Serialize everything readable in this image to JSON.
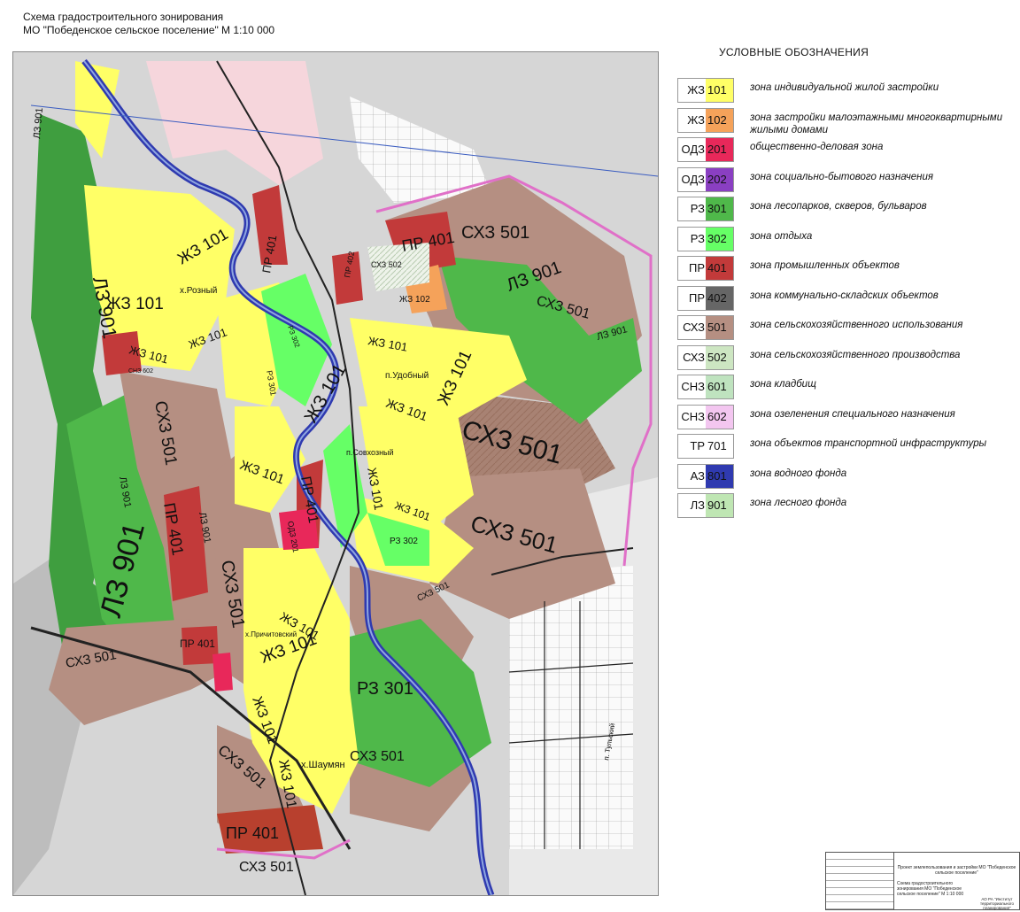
{
  "header": {
    "line1": "Схема градостроительного зонирования",
    "line2": "МО \"Победенское сельское поселение\" М 1:10 000"
  },
  "legend": {
    "title": "УСЛОВНЫЕ ОБОЗНАЧЕНИЯ",
    "items": [
      {
        "prefix": "ЖЗ",
        "num": "101",
        "color": "#ffff66",
        "desc": "зона индивидуальной жилой застройки"
      },
      {
        "prefix": "ЖЗ",
        "num": "102",
        "color": "#f5a25a",
        "desc": "зона застройки малоэтажными многоквартирными жилыми домами"
      },
      {
        "prefix": "ОДЗ",
        "num": "201",
        "color": "#e8285a",
        "desc": "общественно-деловая зона"
      },
      {
        "prefix": "ОДЗ",
        "num": "202",
        "color": "#8a3fc2",
        "desc": "зона социально-бытового назначения"
      },
      {
        "prefix": "РЗ",
        "num": "301",
        "color": "#4fb84a",
        "desc": "зона лесопарков, скверов, бульваров"
      },
      {
        "prefix": "РЗ",
        "num": "302",
        "color": "#66ff66",
        "desc": "зона отдыха"
      },
      {
        "prefix": "ПР",
        "num": "401",
        "color": "#c23a3a",
        "desc": "зона промышленных объектов"
      },
      {
        "prefix": "ПР",
        "num": "402",
        "color": "#666666",
        "desc": "зона коммунально-складских объектов"
      },
      {
        "prefix": "СХЗ",
        "num": "501",
        "color": "#b58f82",
        "desc": "зона сельскохозяйственного использования"
      },
      {
        "prefix": "СХЗ",
        "num": "502",
        "color": "#cde6c2",
        "desc": "зона сельскохозяйственного производства"
      },
      {
        "prefix": "СНЗ",
        "num": "601",
        "color": "#bfe3bf",
        "desc": "зона кладбищ"
      },
      {
        "prefix": "СНЗ",
        "num": "602",
        "color": "#f3c6f0",
        "desc": "зона озеленения специального назначения"
      },
      {
        "prefix": "ТР",
        "num": "701",
        "color": "#ffffff",
        "desc": "зона объектов транспортной инфраструктуры"
      },
      {
        "prefix": "АЗ",
        "num": "801",
        "color": "#2f3ab0",
        "desc": "зона водного фонда"
      },
      {
        "prefix": "ЛЗ",
        "num": "901",
        "color": "#bfe6b3",
        "desc": "зона лесного фонда"
      }
    ]
  },
  "map": {
    "labels": {
      "lz901_big": "ЛЗ 901",
      "lz901_a": "ЛЗ 901",
      "lz901_b": "ЛЗ 901",
      "lz901_c": "ЛЗ 901",
      "lz901_d": "ЛЗ 901",
      "lz901_e": "ЛЗ 901",
      "lz901_f": "ЛЗ 901",
      "zhz101_a": "ЖЗ 101",
      "zhz101_b": "ЖЗ 101",
      "zhz101_c": "ЖЗ 101",
      "zhz101_d": "ЖЗ 101",
      "zhz101_e": "ЖЗ 101",
      "zhz101_f": "ЖЗ 101",
      "zhz101_g": "ЖЗ 101",
      "zhz101_h": "ЖЗ 101",
      "zhz101_i": "ЖЗ 101",
      "zhz101_j": "ЖЗ 101",
      "zhz101_k": "ЖЗ 101",
      "zhz101_l": "ЖЗ 101",
      "zhz101_m": "ЖЗ 101",
      "zhz101_n": "ЖЗ 101",
      "zhz101_o": "ЖЗ 101",
      "zhz102": "ЖЗ 102",
      "pr401_a": "ПР 401",
      "pr401_b": "ПР 401",
      "pr401_c": "ПР 401",
      "pr401_d": "ПР 401",
      "pr401_e": "ПР 401",
      "pr401_f": "ПР 401",
      "pr402": "ПР 402",
      "shz501_a": "СХЗ 501",
      "shz501_b": "СХЗ 501",
      "shz501_c": "СХЗ 501",
      "shz501_d": "СХЗ 501",
      "shz501_e": "СХЗ 501",
      "shz501_f": "СХЗ 501",
      "shz501_g": "СХЗ 501",
      "shz501_h": "СХЗ 501",
      "shz501_i": "СХЗ 501",
      "shz501_j": "СХЗ 501",
      "shz501_k": "СХЗ 501",
      "shz502": "СХЗ 502",
      "snz602": "СНЗ 602",
      "rz301_a": "РЗ 301",
      "rz301_b": "РЗ 301",
      "rz302_a": "РЗ 302",
      "rz302_b": "РЗ 302",
      "odz201": "ОДЗ 201",
      "place_udobny": "п.Удобный",
      "place_rozny": "х.Розный",
      "place_sovkhozny": "п.Совхозный",
      "place_prichitovsky": "х.Причитовский",
      "place_shaumyan": "х.Шаумян",
      "place_tulsky": "п. Тульский"
    }
  },
  "stamp": {
    "project": "Проект землепользования и застройки МО \"Победенское сельское поселение\"",
    "sheet": "Схема градостроительного зонирования МО \"Победенское сельское поселение\" М 1:10 000",
    "org": "АО РА \"Институт территориального планирования\""
  }
}
